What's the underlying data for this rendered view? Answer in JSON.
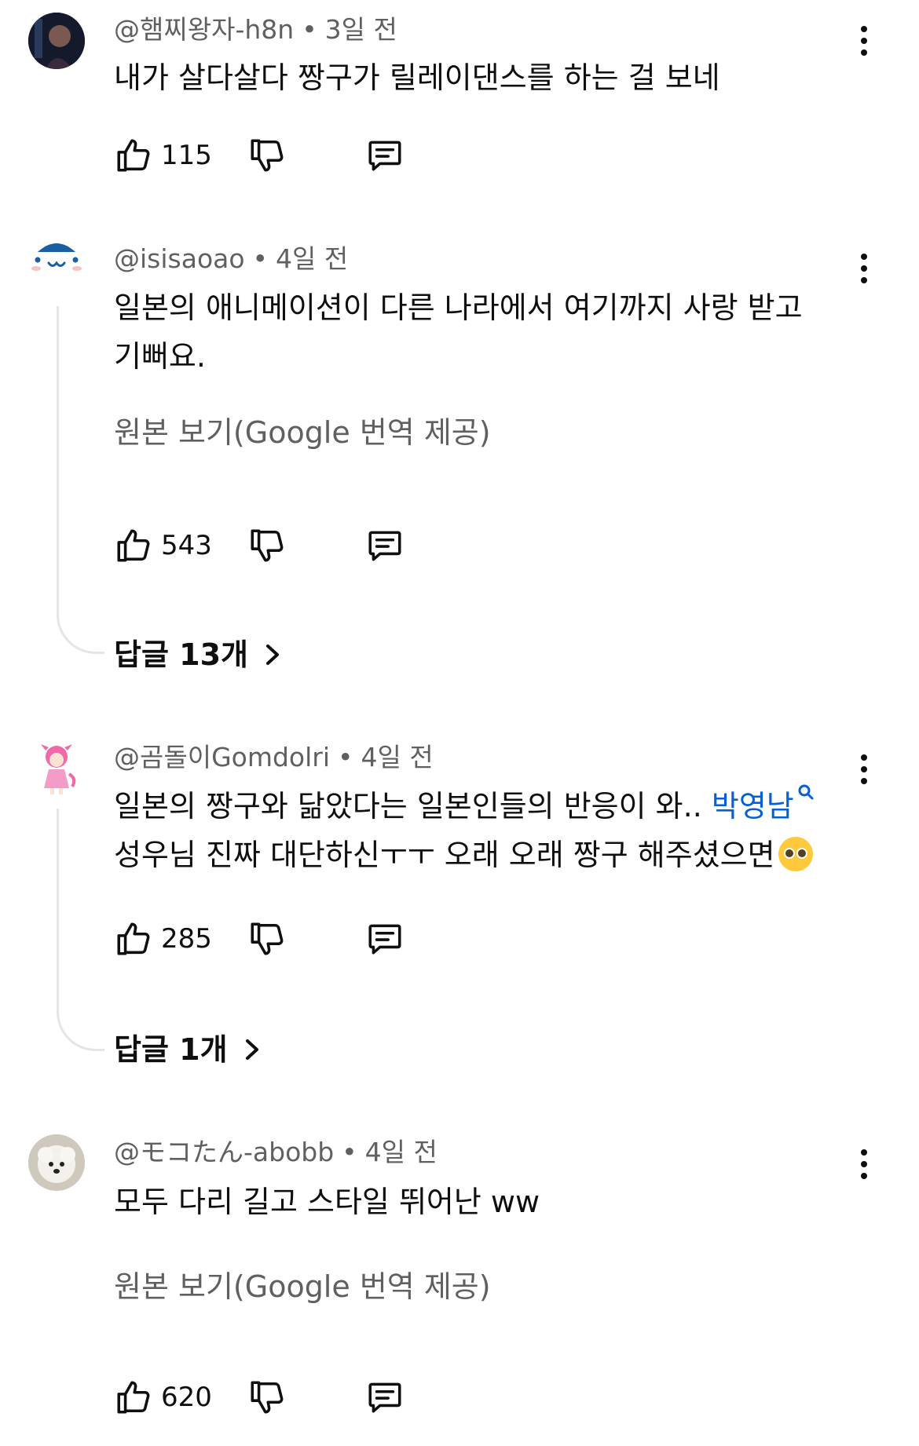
{
  "comments": [
    {
      "author": "@햄찌왕자-h8n",
      "time": "3일 전",
      "lines": [
        "내가 살다살다 짱구가 릴레이댄스를 하는 걸 보네"
      ],
      "likes": "115"
    },
    {
      "author": "@isisaoao",
      "time": "4일 전",
      "lines": [
        "일본의 애니메이션이 다른 나라에서 여기까지 사랑 받고",
        "기뻐요."
      ],
      "translate": "원본 보기(Google 번역 제공)",
      "likes": "543",
      "replies": "답글 13개"
    },
    {
      "author": "@곰돌이Gomdolri",
      "time": "4일 전",
      "line1": "일본의 짱구와 닮았다는 일본인들의 반응이 와.. ",
      "link": "박영남",
      "line2": "성우님 진짜 대단하신ㅜㅜ 오래 오래 짱구 해주셨으면",
      "likes": "285",
      "replies": "답글 1개"
    },
    {
      "author": "@モコたん-abobb",
      "time": "4일 전",
      "lines": [
        "모두 다리 길고 스타일 뛰어난 ww"
      ],
      "translate": "원본 보기(Google 번역 제공)",
      "likes": "620"
    }
  ],
  "separator": "•",
  "colors": {
    "link": "#065fd4",
    "secondary": "#606060",
    "text": "#0f0f0f"
  },
  "icons": [
    "like-icon",
    "dislike-icon",
    "reply-icon",
    "more-vert-icon",
    "search-icon",
    "chevron-right-icon",
    "pleading-face-emoji"
  ]
}
